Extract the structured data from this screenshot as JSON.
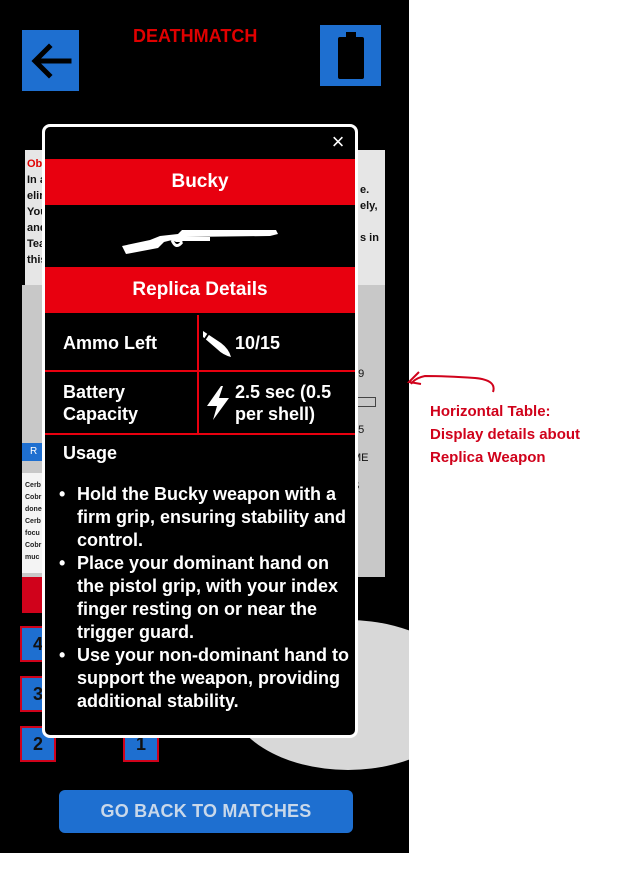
{
  "header": {
    "mode_title": "DEATHMATCH",
    "back_icon": "arrow-left-icon",
    "battery_icon": "battery-icon"
  },
  "background": {
    "panel_lines": [
      "Obj",
      "In a",
      "elin",
      "You",
      "and",
      "Tea",
      "this"
    ],
    "panel_right_lines": [
      "e.",
      "ely,",
      "s in"
    ],
    "small_button_label": "R",
    "list_lines": [
      "Cerb",
      "Cobr",
      "done",
      "Cerb",
      "focu",
      "Cobr",
      "muc"
    ],
    "right_labels": [
      "99",
      "35",
      "ME",
      "S"
    ],
    "number_buttons": [
      "4",
      "3",
      "2",
      "1"
    ]
  },
  "modal": {
    "close_label": "×",
    "weapon_name": "Bucky",
    "section_title": "Replica Details",
    "table": [
      {
        "label": "Ammo Left",
        "icon": "bullet-icon",
        "value": "10/15"
      },
      {
        "label": "Battery Capacity",
        "icon": "lightning-icon",
        "value": "2.5 sec (0.5 per shell)"
      }
    ],
    "usage_title": "Usage",
    "usage_items": [
      "Hold the Bucky weapon with a firm grip, ensuring stability and control.",
      "Place your dominant hand on the pistol grip, with your index finger resting on or near the trigger guard.",
      "Use your non-dominant hand to support the weapon, providing additional stability."
    ]
  },
  "footer": {
    "go_back_label": "GO BACK TO MATCHES"
  },
  "annotation": {
    "lines": [
      "Horizontal Table:",
      "Display details about",
      "Replica Weapon"
    ]
  },
  "colors": {
    "accent_red": "#e8000f",
    "accent_blue": "#1e6fd0",
    "annotation_red": "#d0021b"
  }
}
